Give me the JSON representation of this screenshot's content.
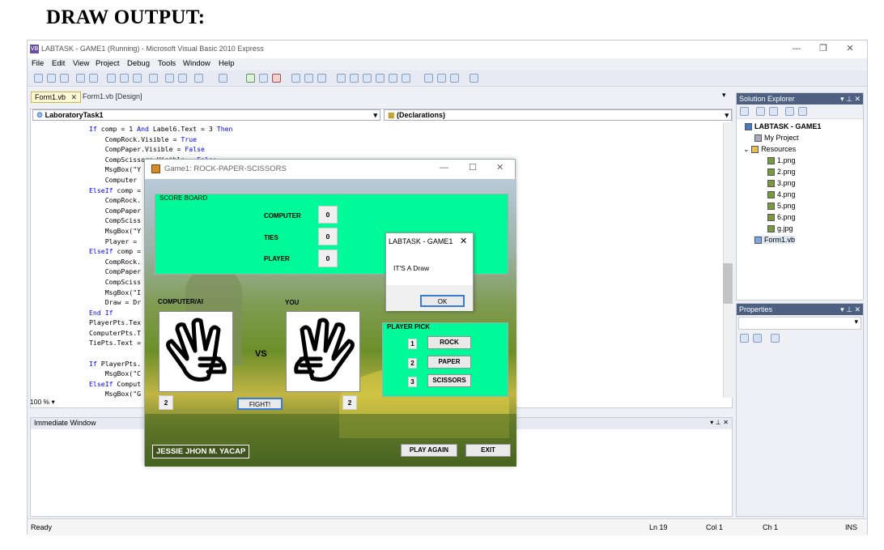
{
  "heading": "DRAW OUTPUT:",
  "ide": {
    "title": "LABTASK - GAME1 (Running) - Microsoft Visual Basic 2010 Express",
    "menu": [
      "File",
      "Edit",
      "View",
      "Project",
      "Debug",
      "Tools",
      "Window",
      "Help"
    ],
    "tabs": [
      "Form1.vb",
      "Form1.vb [Design]"
    ],
    "class_dropdown": "LaboratoryTask1",
    "method_dropdown": "(Declarations)",
    "code_lines": [
      "If comp = 1 And Label6.Text = 3 Then",
      "    CompRock.Visible = True",
      "    CompPaper.Visible = False",
      "    CompScissors.Visible = False",
      "    MsgBox(\"Y",
      "    Computer",
      "ElseIf comp =",
      "    CompRock.",
      "    CompPaper",
      "    CompSciss",
      "    MsgBox(\"Y",
      "    Player =",
      "ElseIf comp =",
      "    CompRock.",
      "    CompPaper",
      "    CompSciss",
      "    MsgBox(\"I",
      "    Draw = Dr",
      "End If",
      "PlayerPts.Tex",
      "ComputerPts.T",
      "TiePts.Text =",
      "",
      "If PlayerPts.",
      "    MsgBox(\"C",
      "ElseIf Comput",
      "    MsgBox(\"G"
    ],
    "zoom": "100 %",
    "immediate_title": "Immediate Window",
    "solution_explorer": {
      "title": "Solution Explorer",
      "project": "LABTASK - GAME1",
      "items": [
        "My Project",
        "Resources",
        "1.png",
        "2.png",
        "3.png",
        "4.png",
        "5.png",
        "6.png",
        "g.jpg",
        "Form1.vb"
      ]
    },
    "properties_title": "Properties",
    "status": {
      "ready": "Ready",
      "ln": "Ln 19",
      "col": "Col 1",
      "ch": "Ch 1",
      "ins": "INS"
    }
  },
  "game": {
    "title": "Game1: ROCK-PAPER-SCISSORS",
    "scoreboard": {
      "title": "SCORE BOARD",
      "computer_label": "COMPUTER",
      "computer_score": "0",
      "ties_label": "TIES",
      "ties_score": "0",
      "player_label": "PLAYER",
      "player_score": "0"
    },
    "computer_label": "COMPUTER/AI",
    "you_label": "YOU",
    "vs": "VS",
    "computer_pick": "2",
    "player_pick": "2",
    "fight": "FIGHT!",
    "player_pick_panel": {
      "title": "PLAYER PICK",
      "options": [
        {
          "num": "1",
          "label": "ROCK"
        },
        {
          "num": "2",
          "label": "PAPER"
        },
        {
          "num": "3",
          "label": "SCISSORS"
        }
      ]
    },
    "author": "JESSIE JHON M. YACAP",
    "play_again": "PLAY AGAIN",
    "exit": "EXIT"
  },
  "msgbox": {
    "title": "LABTASK - GAME1",
    "message": "IT'S A Draw",
    "ok": "OK"
  }
}
